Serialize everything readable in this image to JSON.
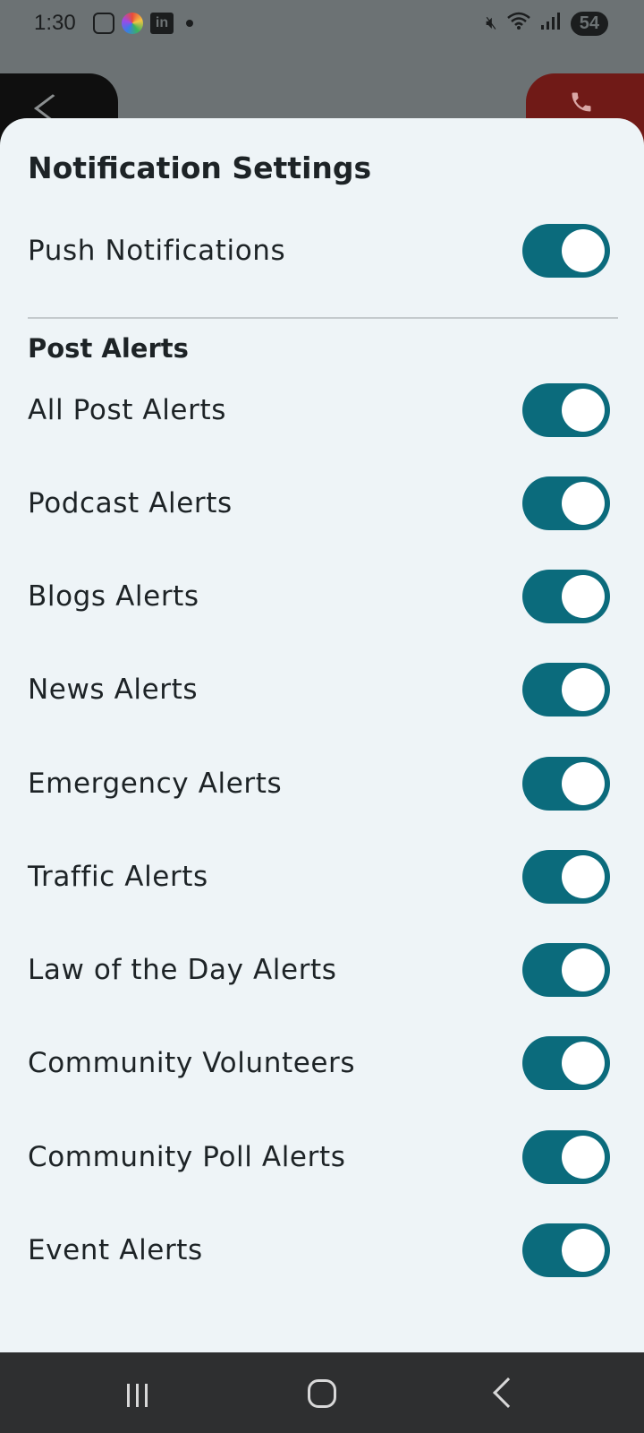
{
  "status_bar": {
    "time": "1:30",
    "battery": "54",
    "icons_left": [
      "screenshot-icon",
      "app-icon",
      "linkedin-icon",
      "notification-dot-icon"
    ],
    "linkedin_text": "in",
    "icons_right": [
      "mute-icon",
      "wifi-icon",
      "signal-icon",
      "battery-icon"
    ]
  },
  "sheet": {
    "title": "Notification Settings",
    "push": {
      "label": "Push Notifications",
      "enabled": true
    },
    "section_label": "Post Alerts",
    "items": [
      {
        "label": "All Post Alerts",
        "enabled": true
      },
      {
        "label": "Podcast Alerts",
        "enabled": true
      },
      {
        "label": "Blogs Alerts",
        "enabled": true
      },
      {
        "label": "News Alerts",
        "enabled": true
      },
      {
        "label": "Emergency Alerts",
        "enabled": true
      },
      {
        "label": "Traffic Alerts",
        "enabled": true
      },
      {
        "label": "Law of the Day Alerts",
        "enabled": true
      },
      {
        "label": "Community Volunteers",
        "enabled": true
      },
      {
        "label": "Community Poll Alerts",
        "enabled": true
      },
      {
        "label": "Event Alerts",
        "enabled": true
      }
    ]
  },
  "colors": {
    "toggle_on": "#0b6b7c",
    "sheet_bg": "#eef4f7",
    "scrim": "#6c7274",
    "call_button": "#701a17"
  },
  "nav_bar": {
    "icons": [
      "recent-apps-icon",
      "home-icon",
      "back-icon"
    ]
  }
}
